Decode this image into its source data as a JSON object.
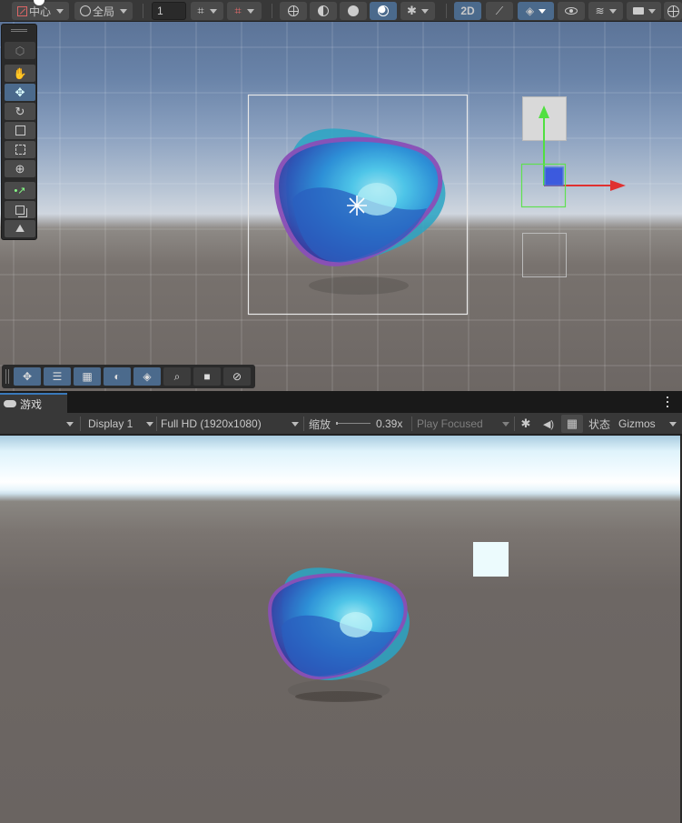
{
  "scene_toolbar": {
    "pivot_label": "中心",
    "space_label": "全局",
    "snap_value": "1",
    "mode_2d_label": "2D"
  },
  "game_tab": {
    "label": "游戏"
  },
  "game_toolbar": {
    "display": "Display 1",
    "resolution": "Full HD (1920x1080)",
    "scale_label": "缩放",
    "scale_value": "0.39x",
    "play_mode": "Play Focused",
    "stats_label": "状态",
    "gizmos_label": "Gizmos"
  },
  "colors": {
    "accent": "#3a79bb",
    "active_button": "#4b6a8c",
    "axis_x": "#e03030",
    "axis_y": "#50e040",
    "axis_z": "#3050e0"
  }
}
